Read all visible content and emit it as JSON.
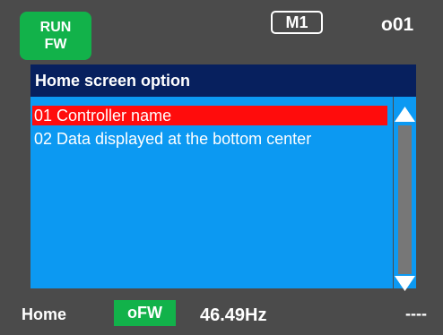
{
  "status": {
    "run_line1": "RUN",
    "run_line2": "FW",
    "mode": "M1",
    "screen_code": "o01"
  },
  "panel": {
    "title": "Home screen option",
    "items": [
      {
        "label": "01 Controller name",
        "selected": true
      },
      {
        "label": "02 Data displayed at the bottom center",
        "selected": false
      }
    ]
  },
  "footer": {
    "home_label": "Home",
    "direction": "oFW",
    "frequency": "46.49Hz",
    "extra": "----"
  },
  "colors": {
    "background": "#4b4b4b",
    "run_green": "#12b24a",
    "title_bar": "#07205e",
    "list_background": "#0c99f2",
    "selected_row": "#ff0c0c",
    "scroll_track": "#777777",
    "text": "#ffffff"
  },
  "icons": {
    "scroll_up": "triangle-up-icon",
    "scroll_down": "triangle-down-icon"
  }
}
